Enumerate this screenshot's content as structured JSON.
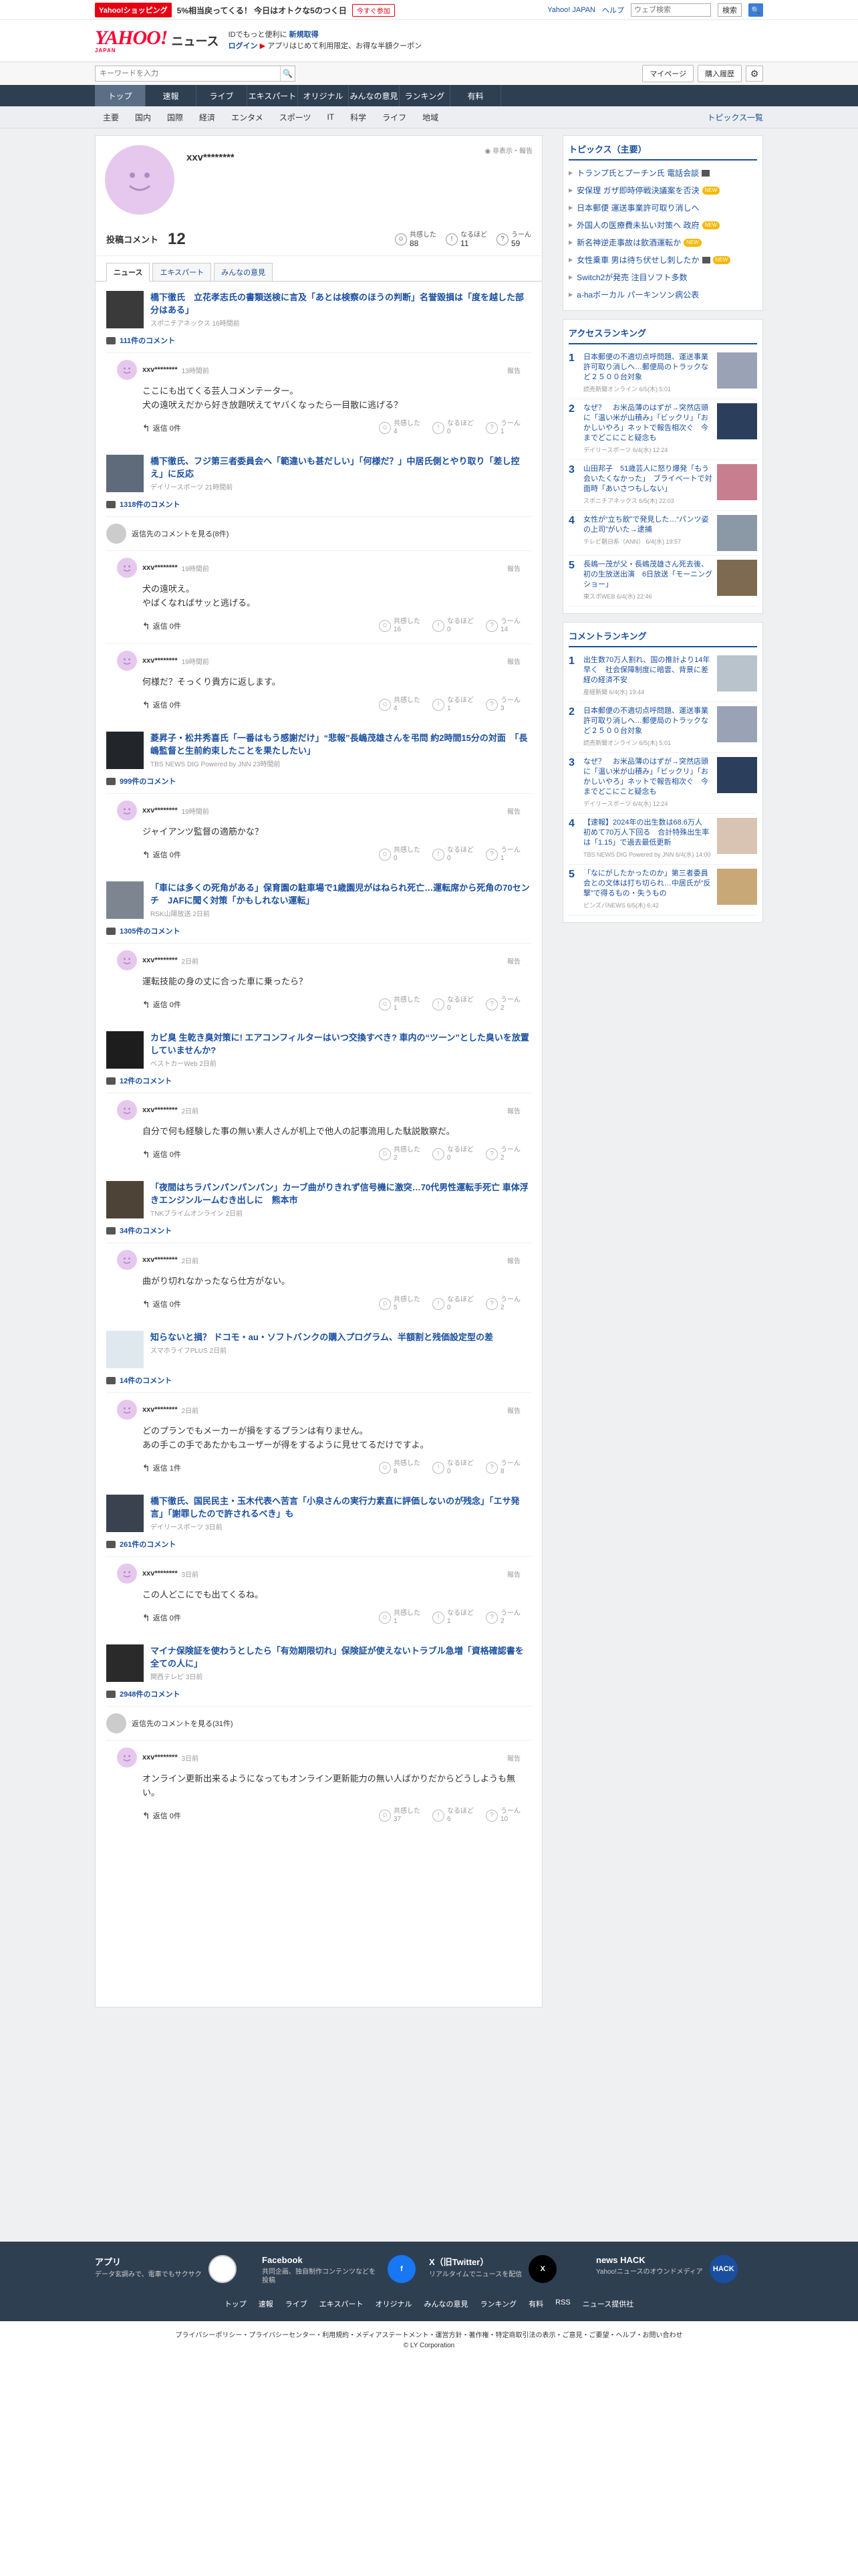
{
  "promo": {
    "shop": "Yahoo!ショッピング",
    "message": "5%相当戻ってくる！ 今日はオトクな5のつく日",
    "now": "今すぐ参加",
    "links": [
      "Yahoo! JAPAN",
      "ヘルプ"
    ],
    "web_search_placeholder": "ウェブ検索",
    "search_label": "検索"
  },
  "header": {
    "logo": "YAHOO!",
    "logo_sub": "JAPAN",
    "logo_news": "ニュース",
    "line1_pre": "IDでもっと便利に",
    "line1_link": "新規取得",
    "line2_link": "ログイン",
    "line2_text": "アプリはじめて利用限定、お得な半額クーポン",
    "search_placeholder": "キーワードを入力",
    "mypage": "マイページ",
    "history": "購入履歴"
  },
  "nav": [
    "トップ",
    "速報",
    "ライブ",
    "エキスパート",
    "オリジナル",
    "みんなの意見",
    "ランキング",
    "有料"
  ],
  "subnav": [
    "主要",
    "国内",
    "国際",
    "経済",
    "エンタメ",
    "スポーツ",
    "IT",
    "科学",
    "ライフ",
    "地域"
  ],
  "subnav_list": "トピックス一覧",
  "profile": {
    "name": "xxv********",
    "tools": "非表示・報告",
    "comment_label": "投稿コメント",
    "comment_count": "12",
    "reactions": [
      {
        "label": "共感した",
        "value": "88"
      },
      {
        "label": "なるほど",
        "value": "11"
      },
      {
        "label": "うーん",
        "value": "59"
      }
    ],
    "tabs": [
      "ニュース",
      "エキスパート",
      "みんなの意見"
    ]
  },
  "feed": [
    {
      "title": "橋下徹氏　立花孝志氏の書類送検に言及「あとは検察のほうの判断」名誉毀損は「度を越した部分はある」",
      "source": "スポニチアネックス 16時間前",
      "count": "111件のコメント",
      "thumb": "#3a3a3a",
      "comments": [
        {
          "name": "xxv********",
          "time": "13時間前",
          "body": "ここにも出てくる芸人コメンテーター。\n犬の遠吠えだから好き放題吠えてヤバくなったら一目散に逃げる？",
          "replies": "返信 0件",
          "r": [
            "4",
            "0",
            "1"
          ]
        }
      ]
    },
    {
      "title": "橋下徹氏、フジ第三者委員会へ「範違いも甚だしい」「何様だ？」中居氏側とやり取り「差し控え」に反応",
      "source": "デイリースポーツ 21時間前",
      "count": "1318件のコメント",
      "thumb": "#5f6b7a",
      "parent": "返信先のコメントを見る(8件)",
      "comments": [
        {
          "name": "xxv********",
          "time": "19時間前",
          "body": "犬の遠吠え。\nやばくなればサッと逃げる。",
          "replies": "返信 0件",
          "r": [
            "16",
            "0",
            "14"
          ]
        },
        {
          "name": "xxv********",
          "time": "19時間前",
          "body": "何様だ？そっくり貴方に返します。",
          "replies": "返信 0件",
          "r": [
            "4",
            "1",
            "3"
          ]
        }
      ]
    },
    {
      "title": "菱昇子・松井秀喜氏「一番はもう感謝だけ」“悲報”長嶋茂雄さんを弔問 約2時間15分の対面　「長嶋監督と生前約束したことを果たしたい」",
      "source": "TBS NEWS DIG Powered by JNN 23時間前",
      "count": "999件のコメント",
      "thumb": "#22252a",
      "comments": [
        {
          "name": "xxv********",
          "time": "19時間前",
          "body": "ジャイアンツ監督の適筋かな？",
          "replies": "返信 0件",
          "r": [
            "0",
            "0",
            "1"
          ]
        }
      ]
    },
    {
      "title": "「車には多くの死角がある」保育園の駐車場で1歳園児がはねられ死亡…運転席から死角の70センチ　JAFに聞く対策「かもしれない運転」",
      "source": "RSK山陽放送 2日前",
      "count": "1305件のコメント",
      "thumb": "#7c8590",
      "comments": [
        {
          "name": "xxv********",
          "time": "2日前",
          "body": "運転技能の身の丈に合った車に乗ったら？",
          "replies": "返信 0件",
          "r": [
            "1",
            "0",
            "2"
          ]
        }
      ]
    },
    {
      "title": "カビ臭 生乾き臭対策に! エアコンフィルターはいつ交換すべき? 車内の“ツーン”とした臭いを放置していませんか?",
      "source": "ベストカーWeb 2日前",
      "count": "12件のコメント",
      "thumb": "#1d1d1d",
      "comments": [
        {
          "name": "xxv********",
          "time": "2日前",
          "body": "自分で何も経験した事の無い素人さんが机上で他人の記事流用した駄説散察だ。",
          "replies": "返信 0件",
          "r": [
            "2",
            "0",
            "2"
          ]
        }
      ]
    },
    {
      "title": "「夜間はちラパンパンパンパン」カーブ曲がりきれず信号機に激突…70代男性運転手死亡 車体浮きエンジンルームむき出しに　熊本市",
      "source": "TNKブライムオンライン 2日前",
      "count": "34件のコメント",
      "thumb": "#4d4336",
      "comments": [
        {
          "name": "xxv********",
          "time": "2日前",
          "body": "曲がり切れなかったなら仕方がない。",
          "replies": "返信 0件",
          "r": [
            "5",
            "0",
            "2"
          ]
        }
      ]
    },
    {
      "title": "知らないと損？ ドコモ・au・ソフトバンクの購入プログラム、半額割と残価設定型の差",
      "source": "スマホライフPLUS 2日前",
      "count": "14件のコメント",
      "thumb": "#dfe8ee",
      "comments": [
        {
          "name": "xxv********",
          "time": "2日前",
          "body": "どのプランでもメーカーが損をするプランは有りません。\nあの手この手であたかもユーザーが得をするように見せてるだけですよ。",
          "replies": "返信 1件",
          "r": [
            "8",
            "0",
            "8"
          ]
        }
      ]
    },
    {
      "title": "橋下徹氏、国民民主・玉木代表へ苦言「小泉さんの実行力素直に評価しないのが残念」「エサ発言」「謝罪したので許されるべき」も",
      "source": "デイリースポーツ 3日前",
      "count": "261件のコメント",
      "thumb": "#3a4250",
      "comments": [
        {
          "name": "xxv********",
          "time": "3日前",
          "body": "この人どこにでも出てくるね。",
          "replies": "返信 0件",
          "r": [
            "1",
            "1",
            "2"
          ]
        }
      ]
    },
    {
      "title": "マイナ保険証を使わうとしたら「有効期限切れ」保険証が使えないトラブル急増「資格確認書を全ての人に」",
      "source": "関西テレビ 3日前",
      "count": "2948件のコメント",
      "thumb": "#2a2a2a",
      "parent": "返信先のコメントを見る(31件)",
      "comments": [
        {
          "name": "xxv********",
          "time": "3日前",
          "body": "オンライン更新出来るようになってもオンライン更新能力の無い人ばかりだからどうしようも無い。",
          "replies": "返信 0件",
          "r": [
            "37",
            "6",
            "10"
          ]
        }
      ]
    }
  ],
  "sidebar": {
    "topics_title": "トピックス（主要）",
    "topics": [
      {
        "t": "トランプ氏とプーチン氏 電話会談",
        "mark": "cam"
      },
      {
        "t": "安保理 ガザ即時停戦決議案を否決",
        "mark": "new"
      },
      {
        "t": "日本郵便 運送事業許可取り消しへ",
        "mark": ""
      },
      {
        "t": "外国人の医療費未払い対策へ 政府",
        "mark": "new"
      },
      {
        "t": "新名神逆走事故は飲酒運転か",
        "mark": "new"
      },
      {
        "t": "女性乗車 男は待ち伏せし刺したか",
        "mark": "camnew"
      },
      {
        "t": "Switch2が発売 注目ソフト多数",
        "mark": ""
      },
      {
        "t": "a-haボーカル パーキンソン病公表",
        "mark": ""
      }
    ],
    "access_title": "アクセスランキング",
    "access": [
      {
        "t": "日本郵便の不適切点呼問題、運送事業許可取り消しへ…郵便局のトラックなど２５００台対象",
        "s": "読売新聞オンライン 6/5(木) 5:01",
        "img": "#9aa3b5"
      },
      {
        "t": "なぜ？　お米品薄のはずが→突然店頭に「温い米が山積み」「ビックリ」「おかしいやろ」ネットで報告相次ぐ　今までどこにこと疑念も",
        "s": "デイリースポーツ 6/4(水) 12:24",
        "img": "#2b3f5c"
      },
      {
        "t": "山田邦子　51歳芸人に怒り爆発「もう会いたくなかった」　ブライベートで対面時「あいさつもしない」",
        "s": "スポニチアネックス 6/5(木) 22:03",
        "img": "#c77f8f"
      },
      {
        "t": "女性が“立ち飲”で発見した…“パンツ姿の上司”がいた→逮捕",
        "s": "テレビ朝日系（ANN） 6/4(水) 19:57",
        "img": "#8b98a6"
      },
      {
        "t": "長嶋一茂が父・長嶋茂雄さん死去後、初の生放送出演　6日放送「モーニングショー」",
        "s": "東スポWEB 6/4(水) 22:46",
        "img": "#7d6a50"
      }
    ],
    "comment_title": "コメントランキング",
    "comment_rank": [
      {
        "t": "出生数70万人割れ、国の推計より14年早く　社会保障制度に暗雲、背景に差経の経済不安",
        "s": "産経新聞 6/4(水) 19:44",
        "img": "#b8c3cc"
      },
      {
        "t": "日本郵便の不適切点呼問題、運送事業許可取り消しへ…郵便局のトラックなど２５００台対象",
        "s": "読売新聞オンライン 6/5(木) 5:01",
        "img": "#9aa3b5"
      },
      {
        "t": "なぜ？　お米品薄のはずが→突然店頭に「温い米が山積み」「ビックリ」「おかしいやろ」ネットで報告相次ぐ　今までどこにこと疑念も",
        "s": "デイリースポーツ 6/4(水) 12:24",
        "img": "#2b3f5c"
      },
      {
        "t": "【速報】2024年の出生数は68.6万人　初めて70万人下回る　合計特殊出生率は「1.15」で過去最低更新",
        "s": "TBS NEWS DIG Powered by JNN 6/4(水) 14:00",
        "img": "#d9c4b4"
      },
      {
        "t": "「なにがしたかったのか」第三者委員会との文体は打ち切られ…中居氏が“反撃”で得るもの・失うもの",
        "s": "ピンズバNEWS 6/5(木) 6:42",
        "img": "#c9a878"
      }
    ]
  },
  "footer": {
    "cols": [
      {
        "t": "アプリ",
        "d": "データ玄調みで、電車でもサクサク",
        "icon": "app"
      },
      {
        "t": "Facebook",
        "d": "共同企画、独自制作コンテンツなどを投稿",
        "icon": "f"
      },
      {
        "t": "X（旧Twitter）",
        "d": "リアルタイムでニュースを配信",
        "icon": "X"
      },
      {
        "t": "news HACK",
        "d": "Yahoo!ニュースのオウンドメディア",
        "icon": "HACK"
      }
    ],
    "nav": [
      "トップ",
      "速報",
      "ライブ",
      "エキスパート",
      "オリジナル",
      "みんなの意見",
      "ランキング",
      "有料",
      "RSS",
      "ニュース提供社"
    ],
    "legal": "プライバシーポリシー・プライバシーセンター・利用規約・メディアステートメント・運営方針・著作権・特定商取引法の表示・ご意見・ご要望・ヘルプ・お問い合わせ",
    "copyright": "© LY Corporation"
  }
}
